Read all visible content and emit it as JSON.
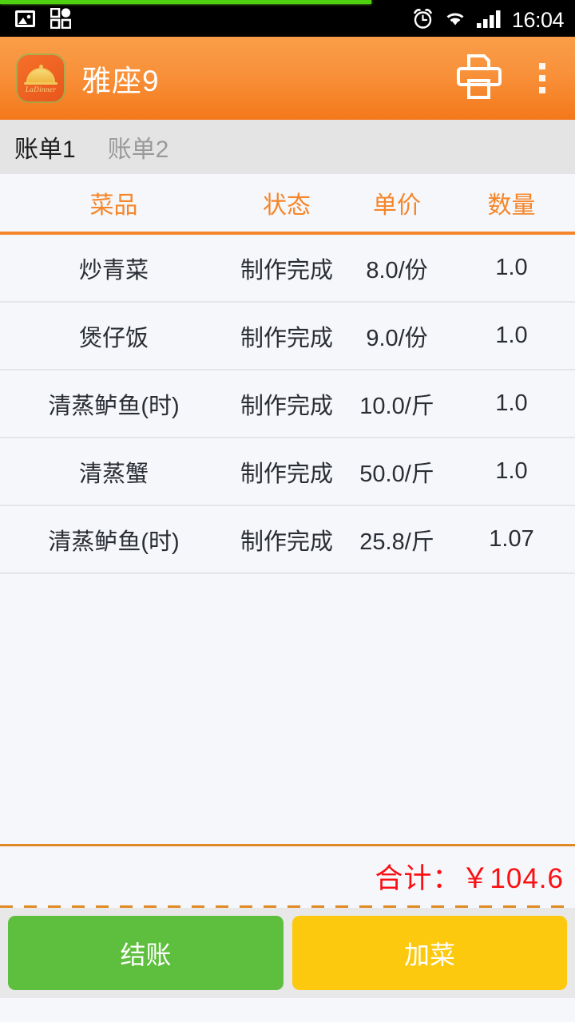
{
  "status_bar": {
    "time": "16:04",
    "left_icons": [
      "image-icon",
      "apps-grid-icon"
    ],
    "right_icons": [
      "alarm-icon",
      "wifi-icon",
      "signal-icon"
    ],
    "progress_color": "#4fd010"
  },
  "action_bar": {
    "title": "雅座9",
    "logo_brand": "LaDinner",
    "logo_name": "ladinner-app-logo",
    "print_icon": "printer-icon",
    "overflow_icon": "overflow-menu-icon",
    "accent_color": "#f4781b"
  },
  "tabs": [
    {
      "label": "账单1",
      "active": true
    },
    {
      "label": "账单2",
      "active": false
    }
  ],
  "table": {
    "headers": {
      "name": "菜品",
      "status": "状态",
      "price": "单价",
      "qty": "数量"
    },
    "header_color": "#f5862a",
    "rows": [
      {
        "name": "炒青菜",
        "status": "制作完成",
        "price": "8.0/份",
        "qty": "1.0"
      },
      {
        "name": "煲仔饭",
        "status": "制作完成",
        "price": "9.0/份",
        "qty": "1.0"
      },
      {
        "name": "清蒸鲈鱼(时)",
        "status": "制作完成",
        "price": "10.0/斤",
        "qty": "1.0"
      },
      {
        "name": "清蒸蟹",
        "status": "制作完成",
        "price": "50.0/斤",
        "qty": "1.0"
      },
      {
        "name": "清蒸鲈鱼(时)",
        "status": "制作完成",
        "price": "25.8/斤",
        "qty": "1.07"
      }
    ]
  },
  "total": {
    "text": "合计：￥104.6",
    "color": "#fb0f12"
  },
  "footer": {
    "checkout_label": "结账",
    "add_dish_label": "加菜",
    "checkout_color": "#5dbf3d",
    "add_dish_color": "#fdc90f"
  }
}
